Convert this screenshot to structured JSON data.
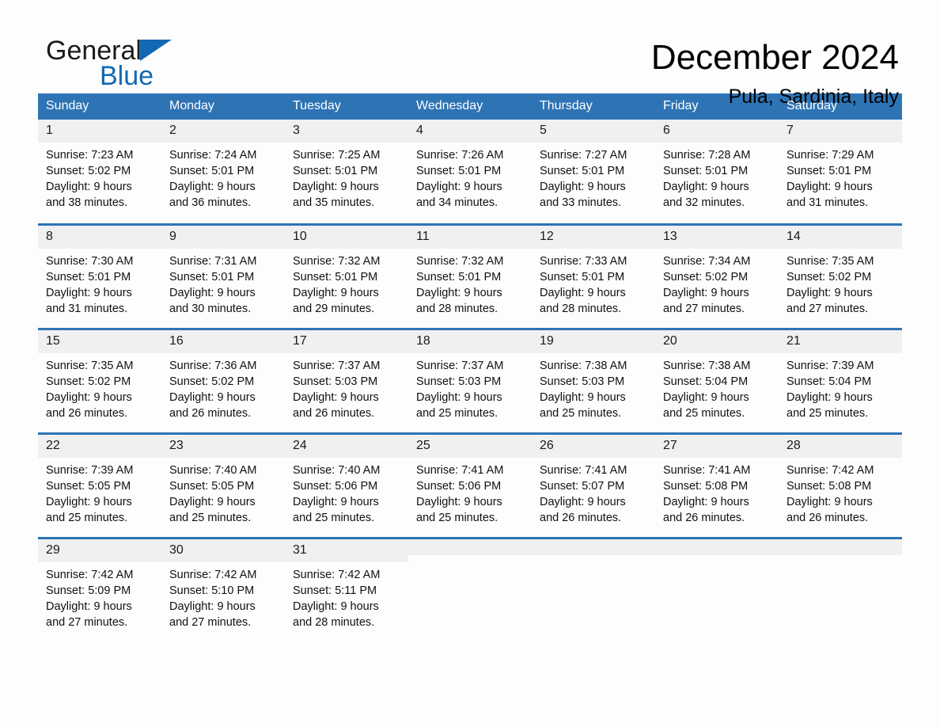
{
  "brand": {
    "name_part1": "General",
    "name_part2": "Blue",
    "flag_color": "#1268b3"
  },
  "header": {
    "month_title": "December 2024",
    "location": "Pula, Sardinia, Italy"
  },
  "theme": {
    "header_blue": "#2e74b5",
    "daynum_band": "#f0f0f0",
    "page_background": "#fdfdfd"
  },
  "weekday_headers": [
    "Sunday",
    "Monday",
    "Tuesday",
    "Wednesday",
    "Thursday",
    "Friday",
    "Saturday"
  ],
  "weeks": [
    [
      {
        "day": "1",
        "sunrise": "Sunrise: 7:23 AM",
        "sunset": "Sunset: 5:02 PM",
        "daylight_l1": "Daylight: 9 hours",
        "daylight_l2": "and 38 minutes."
      },
      {
        "day": "2",
        "sunrise": "Sunrise: 7:24 AM",
        "sunset": "Sunset: 5:01 PM",
        "daylight_l1": "Daylight: 9 hours",
        "daylight_l2": "and 36 minutes."
      },
      {
        "day": "3",
        "sunrise": "Sunrise: 7:25 AM",
        "sunset": "Sunset: 5:01 PM",
        "daylight_l1": "Daylight: 9 hours",
        "daylight_l2": "and 35 minutes."
      },
      {
        "day": "4",
        "sunrise": "Sunrise: 7:26 AM",
        "sunset": "Sunset: 5:01 PM",
        "daylight_l1": "Daylight: 9 hours",
        "daylight_l2": "and 34 minutes."
      },
      {
        "day": "5",
        "sunrise": "Sunrise: 7:27 AM",
        "sunset": "Sunset: 5:01 PM",
        "daylight_l1": "Daylight: 9 hours",
        "daylight_l2": "and 33 minutes."
      },
      {
        "day": "6",
        "sunrise": "Sunrise: 7:28 AM",
        "sunset": "Sunset: 5:01 PM",
        "daylight_l1": "Daylight: 9 hours",
        "daylight_l2": "and 32 minutes."
      },
      {
        "day": "7",
        "sunrise": "Sunrise: 7:29 AM",
        "sunset": "Sunset: 5:01 PM",
        "daylight_l1": "Daylight: 9 hours",
        "daylight_l2": "and 31 minutes."
      }
    ],
    [
      {
        "day": "8",
        "sunrise": "Sunrise: 7:30 AM",
        "sunset": "Sunset: 5:01 PM",
        "daylight_l1": "Daylight: 9 hours",
        "daylight_l2": "and 31 minutes."
      },
      {
        "day": "9",
        "sunrise": "Sunrise: 7:31 AM",
        "sunset": "Sunset: 5:01 PM",
        "daylight_l1": "Daylight: 9 hours",
        "daylight_l2": "and 30 minutes."
      },
      {
        "day": "10",
        "sunrise": "Sunrise: 7:32 AM",
        "sunset": "Sunset: 5:01 PM",
        "daylight_l1": "Daylight: 9 hours",
        "daylight_l2": "and 29 minutes."
      },
      {
        "day": "11",
        "sunrise": "Sunrise: 7:32 AM",
        "sunset": "Sunset: 5:01 PM",
        "daylight_l1": "Daylight: 9 hours",
        "daylight_l2": "and 28 minutes."
      },
      {
        "day": "12",
        "sunrise": "Sunrise: 7:33 AM",
        "sunset": "Sunset: 5:01 PM",
        "daylight_l1": "Daylight: 9 hours",
        "daylight_l2": "and 28 minutes."
      },
      {
        "day": "13",
        "sunrise": "Sunrise: 7:34 AM",
        "sunset": "Sunset: 5:02 PM",
        "daylight_l1": "Daylight: 9 hours",
        "daylight_l2": "and 27 minutes."
      },
      {
        "day": "14",
        "sunrise": "Sunrise: 7:35 AM",
        "sunset": "Sunset: 5:02 PM",
        "daylight_l1": "Daylight: 9 hours",
        "daylight_l2": "and 27 minutes."
      }
    ],
    [
      {
        "day": "15",
        "sunrise": "Sunrise: 7:35 AM",
        "sunset": "Sunset: 5:02 PM",
        "daylight_l1": "Daylight: 9 hours",
        "daylight_l2": "and 26 minutes."
      },
      {
        "day": "16",
        "sunrise": "Sunrise: 7:36 AM",
        "sunset": "Sunset: 5:02 PM",
        "daylight_l1": "Daylight: 9 hours",
        "daylight_l2": "and 26 minutes."
      },
      {
        "day": "17",
        "sunrise": "Sunrise: 7:37 AM",
        "sunset": "Sunset: 5:03 PM",
        "daylight_l1": "Daylight: 9 hours",
        "daylight_l2": "and 26 minutes."
      },
      {
        "day": "18",
        "sunrise": "Sunrise: 7:37 AM",
        "sunset": "Sunset: 5:03 PM",
        "daylight_l1": "Daylight: 9 hours",
        "daylight_l2": "and 25 minutes."
      },
      {
        "day": "19",
        "sunrise": "Sunrise: 7:38 AM",
        "sunset": "Sunset: 5:03 PM",
        "daylight_l1": "Daylight: 9 hours",
        "daylight_l2": "and 25 minutes."
      },
      {
        "day": "20",
        "sunrise": "Sunrise: 7:38 AM",
        "sunset": "Sunset: 5:04 PM",
        "daylight_l1": "Daylight: 9 hours",
        "daylight_l2": "and 25 minutes."
      },
      {
        "day": "21",
        "sunrise": "Sunrise: 7:39 AM",
        "sunset": "Sunset: 5:04 PM",
        "daylight_l1": "Daylight: 9 hours",
        "daylight_l2": "and 25 minutes."
      }
    ],
    [
      {
        "day": "22",
        "sunrise": "Sunrise: 7:39 AM",
        "sunset": "Sunset: 5:05 PM",
        "daylight_l1": "Daylight: 9 hours",
        "daylight_l2": "and 25 minutes."
      },
      {
        "day": "23",
        "sunrise": "Sunrise: 7:40 AM",
        "sunset": "Sunset: 5:05 PM",
        "daylight_l1": "Daylight: 9 hours",
        "daylight_l2": "and 25 minutes."
      },
      {
        "day": "24",
        "sunrise": "Sunrise: 7:40 AM",
        "sunset": "Sunset: 5:06 PM",
        "daylight_l1": "Daylight: 9 hours",
        "daylight_l2": "and 25 minutes."
      },
      {
        "day": "25",
        "sunrise": "Sunrise: 7:41 AM",
        "sunset": "Sunset: 5:06 PM",
        "daylight_l1": "Daylight: 9 hours",
        "daylight_l2": "and 25 minutes."
      },
      {
        "day": "26",
        "sunrise": "Sunrise: 7:41 AM",
        "sunset": "Sunset: 5:07 PM",
        "daylight_l1": "Daylight: 9 hours",
        "daylight_l2": "and 26 minutes."
      },
      {
        "day": "27",
        "sunrise": "Sunrise: 7:41 AM",
        "sunset": "Sunset: 5:08 PM",
        "daylight_l1": "Daylight: 9 hours",
        "daylight_l2": "and 26 minutes."
      },
      {
        "day": "28",
        "sunrise": "Sunrise: 7:42 AM",
        "sunset": "Sunset: 5:08 PM",
        "daylight_l1": "Daylight: 9 hours",
        "daylight_l2": "and 26 minutes."
      }
    ],
    [
      {
        "day": "29",
        "sunrise": "Sunrise: 7:42 AM",
        "sunset": "Sunset: 5:09 PM",
        "daylight_l1": "Daylight: 9 hours",
        "daylight_l2": "and 27 minutes."
      },
      {
        "day": "30",
        "sunrise": "Sunrise: 7:42 AM",
        "sunset": "Sunset: 5:10 PM",
        "daylight_l1": "Daylight: 9 hours",
        "daylight_l2": "and 27 minutes."
      },
      {
        "day": "31",
        "sunrise": "Sunrise: 7:42 AM",
        "sunset": "Sunset: 5:11 PM",
        "daylight_l1": "Daylight: 9 hours",
        "daylight_l2": "and 28 minutes."
      },
      {
        "day": "",
        "sunrise": "",
        "sunset": "",
        "daylight_l1": "",
        "daylight_l2": ""
      },
      {
        "day": "",
        "sunrise": "",
        "sunset": "",
        "daylight_l1": "",
        "daylight_l2": ""
      },
      {
        "day": "",
        "sunrise": "",
        "sunset": "",
        "daylight_l1": "",
        "daylight_l2": ""
      },
      {
        "day": "",
        "sunrise": "",
        "sunset": "",
        "daylight_l1": "",
        "daylight_l2": ""
      }
    ]
  ]
}
